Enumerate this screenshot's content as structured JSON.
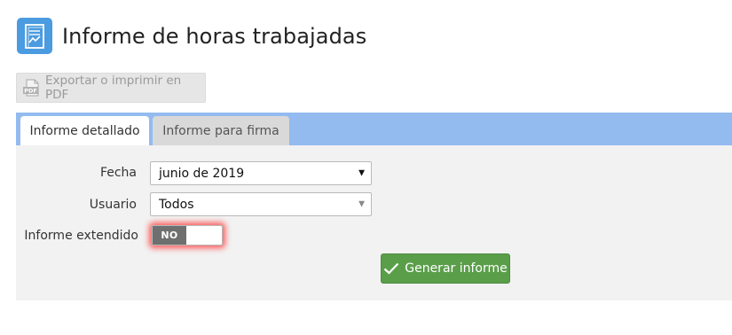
{
  "header": {
    "icon": "report-chart-icon",
    "title": "Informe de horas trabajadas"
  },
  "toolbar": {
    "export_label": "Exportar o imprimir en PDF",
    "export_icon": "pdf-icon",
    "export_disabled": true
  },
  "tabs": [
    {
      "label": "Informe detallado",
      "active": true
    },
    {
      "label": "Informe para firma",
      "active": false
    }
  ],
  "form": {
    "fecha_label": "Fecha",
    "fecha_value": "junio de 2019",
    "usuario_label": "Usuario",
    "usuario_value": "Todos",
    "extendido_label": "Informe extendido",
    "extendido_toggle": "NO",
    "generate_label": "Generar informe",
    "generate_icon": "checkmark-icon"
  },
  "colors": {
    "accent": "#4a9be0",
    "tab_strip": "#93bbef",
    "button_green": "#5a9e4a",
    "toggle_highlight": "#ff2828"
  }
}
